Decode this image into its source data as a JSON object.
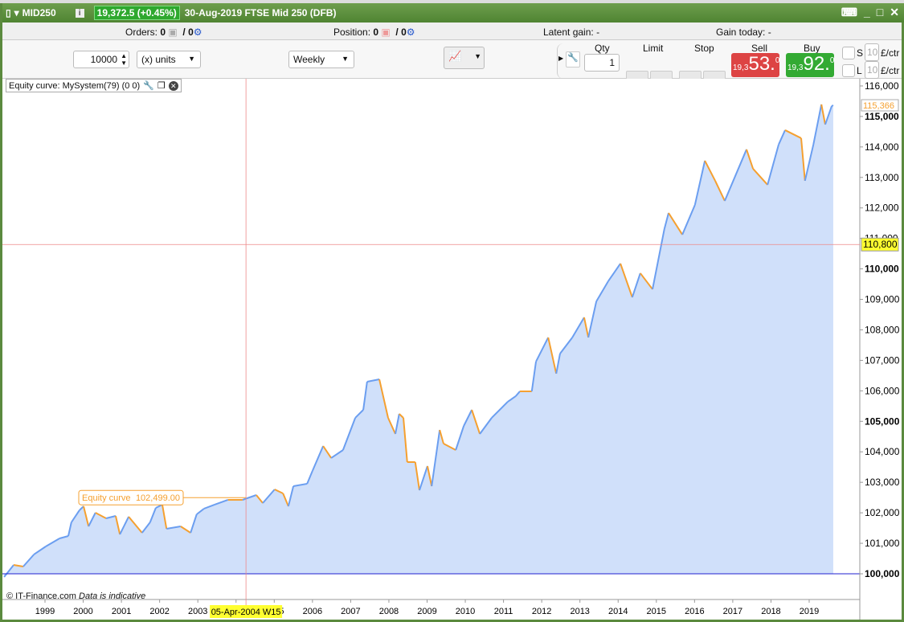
{
  "titlebar": {
    "symbol": "MID250",
    "price_change": "19,372.5 (+0.45%)",
    "description": "30-Aug-2019 FTSE Mid 250 (DFB)"
  },
  "status": {
    "orders_label": "Orders:",
    "orders_value": "0",
    "orders_pending": "/ 0",
    "position_label": "Position:",
    "position_value": "0",
    "position_pending": "/ 0",
    "latent_label": "Latent gain:",
    "latent_value": "-",
    "gain_today_label": "Gain today:",
    "gain_today_value": "-"
  },
  "ticket": {
    "amount": "10000",
    "units": "(x) units",
    "period": "Weekly",
    "qty_label": "Qty",
    "qty": "1",
    "limit_label": "Limit",
    "stop_label": "Stop",
    "sell_label": "Sell",
    "sell_prefix": "19,3",
    "sell_big": "53.",
    "sell_sup": "0",
    "buy_label": "Buy",
    "buy_prefix": "19,3",
    "buy_big": "92.",
    "buy_sup": "0",
    "s_label": "S",
    "l_label": "L",
    "s_val": "10",
    "l_val": "10",
    "per_ctr": "£/ctr"
  },
  "chart_title": "Equity curve: MySystem(79) (0 0)",
  "credit": "© IT-Finance.com",
  "credit_note": "Data is indicative",
  "tooltip": {
    "label": "Equity curve",
    "value": "102,499.00"
  },
  "crosshair": {
    "date": "05-Apr-2004 W15",
    "value": "110,800",
    "year": 2004.26
  },
  "last_value": "115,366",
  "colors": {
    "rise": "#6b9ef0",
    "fall": "#f5a030",
    "fill": "#d0e0fa",
    "baseline": "#2020d0"
  },
  "chart_data": {
    "type": "area",
    "title": "Equity curve: MySystem(79) (0 0)",
    "xlabel": "",
    "ylabel": "",
    "xlim": [
      1997.9,
      2020.3
    ],
    "ylim": [
      99700,
      116300
    ],
    "baseline": 100000,
    "x_ticks": [
      "1999",
      "2000",
      "2001",
      "2002",
      "2003",
      "2004",
      "2005",
      "2006",
      "2007",
      "2008",
      "2009",
      "2010",
      "2011",
      "2012",
      "2013",
      "2014",
      "2015",
      "2016",
      "2017",
      "2018",
      "2019"
    ],
    "y_ticks": [
      "100,000",
      "101,000",
      "102,000",
      "103,000",
      "104,000",
      "105,000",
      "106,000",
      "107,000",
      "108,000",
      "109,000",
      "110,000",
      "111,000",
      "112,000",
      "113,000",
      "114,000",
      "115,000",
      "116,000"
    ],
    "points": [
      [
        1997.93,
        99895
      ],
      [
        1998.18,
        100290
      ],
      [
        1998.43,
        100237
      ],
      [
        1998.71,
        100633
      ],
      [
        1999.02,
        100896
      ],
      [
        1999.38,
        101160
      ],
      [
        1999.61,
        101239
      ],
      [
        1999.69,
        101687
      ],
      [
        1999.9,
        102082
      ],
      [
        2000.01,
        102214
      ],
      [
        2000.14,
        101555
      ],
      [
        2000.32,
        102003
      ],
      [
        2000.6,
        101819
      ],
      [
        2000.85,
        101898
      ],
      [
        2000.96,
        101292
      ],
      [
        2001.19,
        101872
      ],
      [
        2001.54,
        101344
      ],
      [
        2001.75,
        101687
      ],
      [
        2001.9,
        102161
      ],
      [
        2002.07,
        102267
      ],
      [
        2002.18,
        101476
      ],
      [
        2002.55,
        101555
      ],
      [
        2002.81,
        101344
      ],
      [
        2002.97,
        101951
      ],
      [
        2003.16,
        102135
      ],
      [
        2003.44,
        102267
      ],
      [
        2003.79,
        102425
      ],
      [
        2004.17,
        102425
      ],
      [
        2004.53,
        102583
      ],
      [
        2004.7,
        102320
      ],
      [
        2005.01,
        102768
      ],
      [
        2005.23,
        102636
      ],
      [
        2005.37,
        102214
      ],
      [
        2005.5,
        102873
      ],
      [
        2005.86,
        102952
      ],
      [
        2006.0,
        103374
      ],
      [
        2006.28,
        104191
      ],
      [
        2006.49,
        103796
      ],
      [
        2006.8,
        104059
      ],
      [
        2007.12,
        105114
      ],
      [
        2007.33,
        105377
      ],
      [
        2007.43,
        106300
      ],
      [
        2007.75,
        106379
      ],
      [
        2007.98,
        105114
      ],
      [
        2008.17,
        104587
      ],
      [
        2008.27,
        105246
      ],
      [
        2008.38,
        105114
      ],
      [
        2008.48,
        103664
      ],
      [
        2008.69,
        103664
      ],
      [
        2008.8,
        102741
      ],
      [
        2009.01,
        103532
      ],
      [
        2009.12,
        102873
      ],
      [
        2009.33,
        104718
      ],
      [
        2009.43,
        104270
      ],
      [
        2009.75,
        104059
      ],
      [
        2009.96,
        104850
      ],
      [
        2010.17,
        105377
      ],
      [
        2010.38,
        104587
      ],
      [
        2010.69,
        105114
      ],
      [
        2011.11,
        105641
      ],
      [
        2011.32,
        105826
      ],
      [
        2011.43,
        105984
      ],
      [
        2011.74,
        105984
      ],
      [
        2011.85,
        106959
      ],
      [
        2012.17,
        107750
      ],
      [
        2012.38,
        106564
      ],
      [
        2012.48,
        107223
      ],
      [
        2012.8,
        107750
      ],
      [
        2013.11,
        108409
      ],
      [
        2013.22,
        107750
      ],
      [
        2013.43,
        108936
      ],
      [
        2013.74,
        109595
      ],
      [
        2014.06,
        110175
      ],
      [
        2014.37,
        109068
      ],
      [
        2014.58,
        109859
      ],
      [
        2014.9,
        109332
      ],
      [
        2015.21,
        111308
      ],
      [
        2015.32,
        111835
      ],
      [
        2015.68,
        111124
      ],
      [
        2016.01,
        112099
      ],
      [
        2016.27,
        113549
      ],
      [
        2016.54,
        112890
      ],
      [
        2016.79,
        112231
      ],
      [
        2017.36,
        113918
      ],
      [
        2017.53,
        113285
      ],
      [
        2017.91,
        112758
      ],
      [
        2018.2,
        114076
      ],
      [
        2018.37,
        114551
      ],
      [
        2018.79,
        114287
      ],
      [
        2018.89,
        112890
      ],
      [
        2019.11,
        114076
      ],
      [
        2019.32,
        115394
      ],
      [
        2019.42,
        114735
      ],
      [
        2019.59,
        115341
      ],
      [
        2019.63,
        115366
      ]
    ]
  }
}
